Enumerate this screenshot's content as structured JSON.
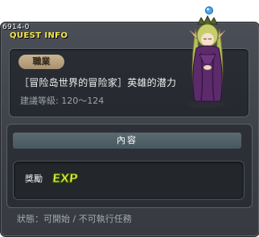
{
  "quest": {
    "code": "6914-0",
    "header": "QUEST INFO",
    "job_badge": "職業",
    "title": "［冒险岛世界的冒险家］英雄的潜力",
    "level": "建議等級: 120～124"
  },
  "content": {
    "header": "內容",
    "reward_label": "獎勵",
    "reward_icon_text": "EXP"
  },
  "status": "狀態：可開始 / 不可執行任務",
  "colors": {
    "header_text": "#f6e64a",
    "badge": "#b8a27f",
    "content_header": "#506066",
    "exp_text": "#e9f23a"
  },
  "icons": {
    "npc": "npc-portrait-icon",
    "exp": "exp-icon"
  }
}
